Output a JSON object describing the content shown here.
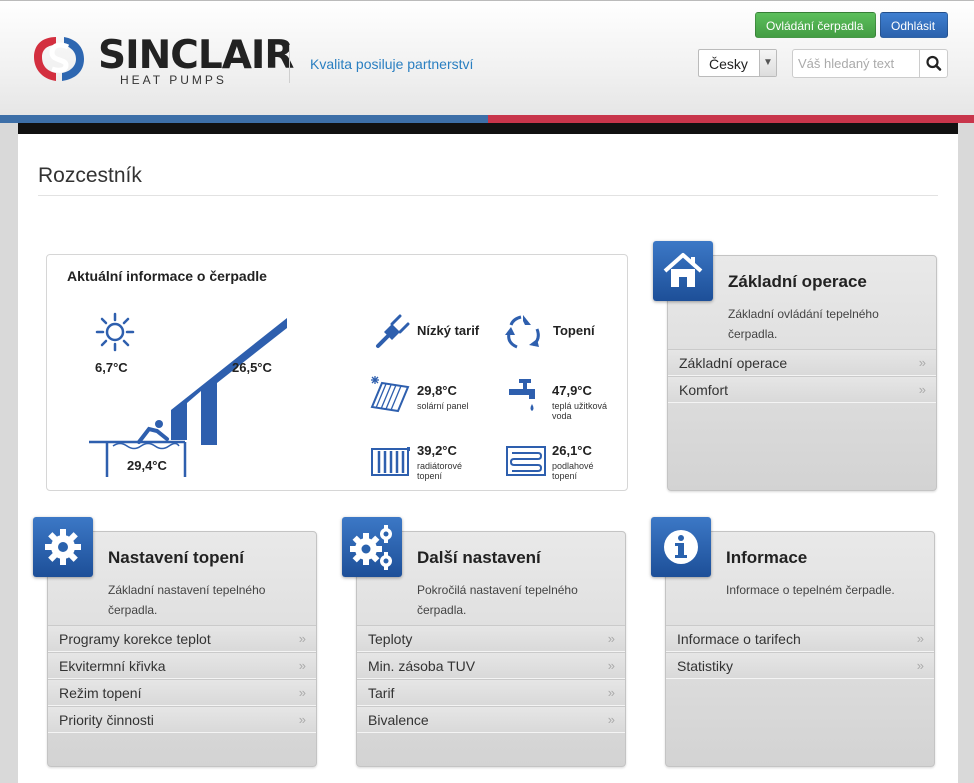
{
  "header": {
    "logo_text": "SINCLAIR",
    "logo_subtitle": "HEAT PUMPS",
    "tagline": "Kvalita posiluje partnerství",
    "btn_control": "Ovládání čerpadla",
    "btn_logout": "Odhlásit",
    "language": "Česky",
    "search_placeholder": "Váš hledaný text"
  },
  "colors": {
    "accent_blue": "#3d6fa8",
    "accent_red": "#c8354b",
    "green": "#449d44",
    "link": "#2a7fc1"
  },
  "page": {
    "title": "Rozcestník"
  },
  "info": {
    "title": "Aktuální informace o čerpadle",
    "outdoor_temp": "6,7°C",
    "indoor_temp": "26,5°C",
    "pool_temp": "29,4°C",
    "tariff": "Nízký tarif",
    "mode": "Topení",
    "solar_temp": "29,8°C",
    "solar_label": "solární panel",
    "water_temp": "47,9°C",
    "water_label_1": "teplá užitková",
    "water_label_2": "voda",
    "radiator_temp": "39,2°C",
    "radiator_label_1": "radiátorové",
    "radiator_label_2": "topení",
    "floor_temp": "26,1°C",
    "floor_label_1": "podlahové",
    "floor_label_2": "topení"
  },
  "tiles": {
    "basic": {
      "title": "Základní operace",
      "desc": "Základní ovládání tepelného čerpadla.",
      "items": [
        "Základní operace",
        "Komfort"
      ],
      "icon": "home-icon"
    },
    "heating": {
      "title": "Nastavení topení",
      "desc": "Základní nastavení tepelného čerpadla.",
      "items": [
        "Programy korekce teplot",
        "Ekvitermní křivka",
        "Režim topení",
        "Priority činnosti"
      ],
      "icon": "gear-icon"
    },
    "other": {
      "title": "Další nastavení",
      "desc": "Pokročilá nastavení tepelného čerpadla.",
      "items": [
        "Teploty",
        "Min. zásoba TUV",
        "Tarif",
        "Bivalence"
      ],
      "icon": "gears-icon"
    },
    "info": {
      "title": "Informace",
      "desc": "Informace o tepelném čerpadle.",
      "items": [
        "Informace o tarifech",
        "Statistiky"
      ],
      "icon": "info-icon"
    }
  },
  "arrow_glyph": "»"
}
